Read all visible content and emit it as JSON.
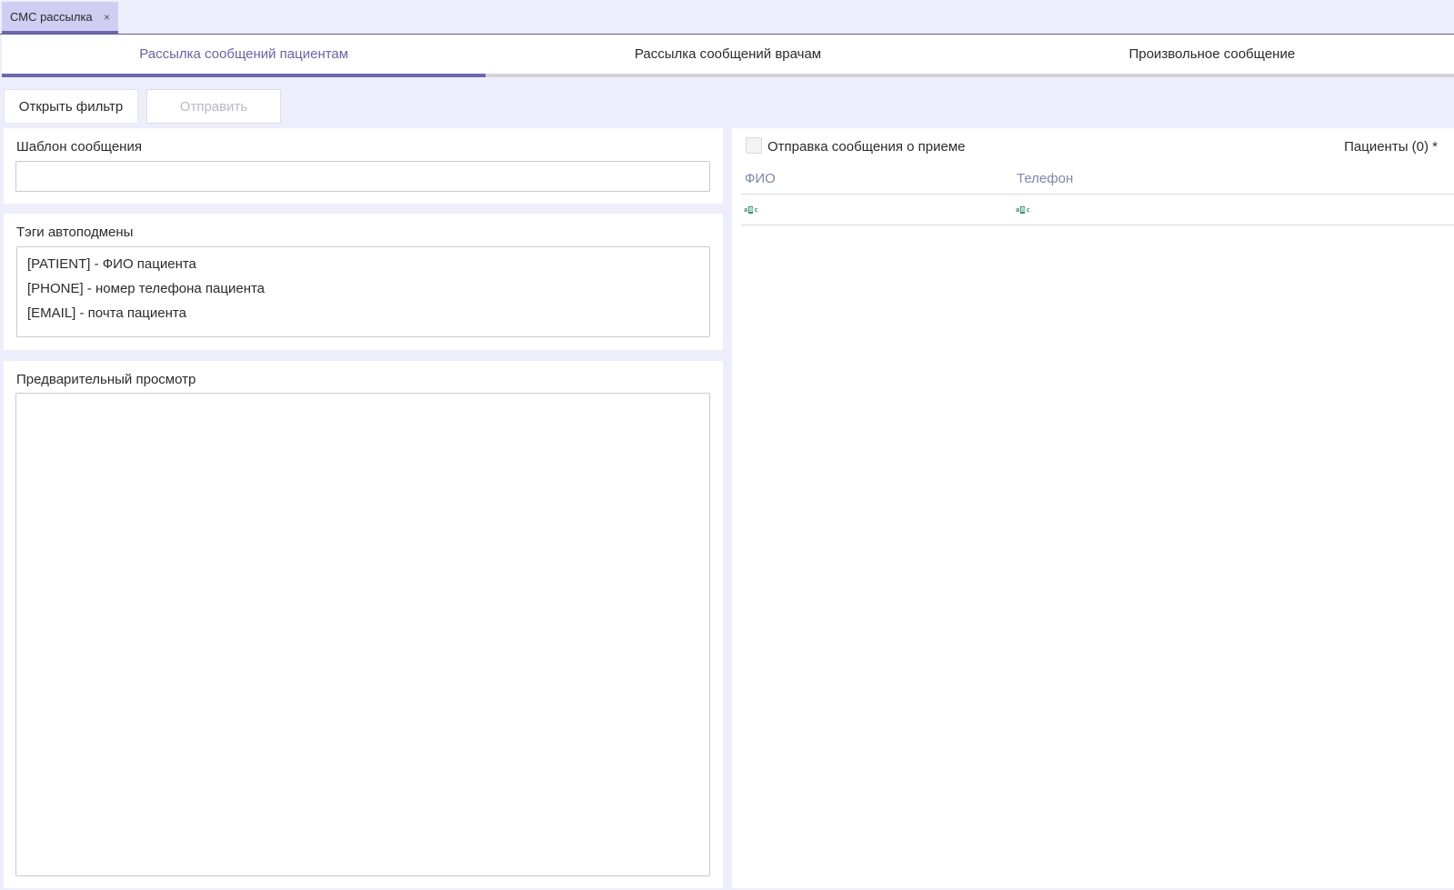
{
  "doc_tab": {
    "label": "СМС рассылка",
    "close_glyph": "×"
  },
  "sub_tabs": [
    {
      "label": "Рассылка сообщений пациентам",
      "active": true
    },
    {
      "label": "Рассылка сообщений врачам",
      "active": false
    },
    {
      "label": "Произвольное сообщение",
      "active": false
    }
  ],
  "toolbar": {
    "open_filter_label": "Открыть фильтр",
    "send_label": "Отправить"
  },
  "template_panel": {
    "title": "Шаблон сообщения",
    "value": ""
  },
  "tags_panel": {
    "title": "Тэги автоподмены",
    "lines": [
      "[PATIENT] - ФИО пациента",
      "[PHONE] - номер телефона пациента",
      "[EMAIL] - почта пациента"
    ]
  },
  "preview_panel": {
    "title": "Предварительный просмотр",
    "value": ""
  },
  "patients_panel": {
    "appointment_checkbox_label": "Отправка сообщения о приеме",
    "appointment_checked": false,
    "patients_count_label": "Пациенты (0) *",
    "columns": [
      "ФИО",
      "Телефон"
    ],
    "filter_icon": "abc-text-filter-icon"
  },
  "colors": {
    "accent": "#6f66b0",
    "background": "#eeedfc",
    "header_text": "#7f86b0"
  }
}
